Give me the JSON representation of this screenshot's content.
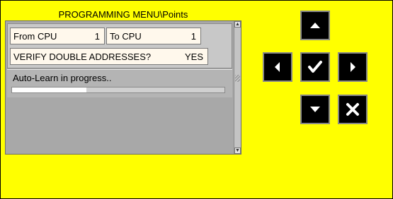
{
  "menu": {
    "title": "PROGRAMMING MENU\\Points",
    "from_cpu_label": "From CPU",
    "from_cpu_value": "1",
    "to_cpu_label": "To CPU",
    "to_cpu_value": "1",
    "verify_label": "VERIFY DOUBLE ADDRESSES?",
    "verify_value": "YES",
    "status_text": "Auto-Learn in progress..",
    "progress_fraction": 0.35
  },
  "nav": {
    "up": "arrow-up-icon",
    "left": "arrow-left-icon",
    "ok": "checkmark-icon",
    "right": "arrow-right-icon",
    "down": "arrow-down-icon",
    "cancel": "cross-icon"
  },
  "colors": {
    "background": "#ffff00",
    "panel": "#a8a8a8",
    "field": "#fff8ec",
    "button": "#000000"
  }
}
